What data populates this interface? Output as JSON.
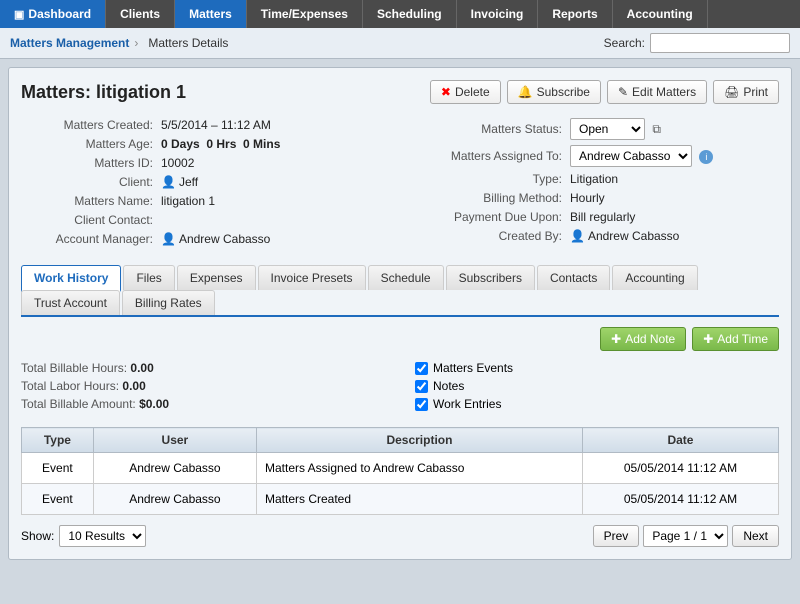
{
  "nav": {
    "items": [
      {
        "id": "dashboard",
        "label": "Dashboard",
        "icon": "▣",
        "active": false
      },
      {
        "id": "clients",
        "label": "Clients",
        "icon": "",
        "active": false
      },
      {
        "id": "matters",
        "label": "Matters",
        "icon": "",
        "active": true
      },
      {
        "id": "time_expenses",
        "label": "Time/Expenses",
        "icon": "",
        "active": false
      },
      {
        "id": "scheduling",
        "label": "Scheduling",
        "icon": "",
        "active": false
      },
      {
        "id": "invoicing",
        "label": "Invoicing",
        "icon": "",
        "active": false
      },
      {
        "id": "reports",
        "label": "Reports",
        "icon": "",
        "active": false
      },
      {
        "id": "accounting",
        "label": "Accounting",
        "icon": "",
        "active": false
      }
    ]
  },
  "breadcrumb": {
    "parent": "Matters Management",
    "current": "Matters Details"
  },
  "search": {
    "label": "Search:",
    "placeholder": ""
  },
  "page": {
    "title": "Matters: litigation 1"
  },
  "buttons": {
    "delete": "Delete",
    "subscribe": "Subscribe",
    "edit": "Edit Matters",
    "print": "Print"
  },
  "details": {
    "left": [
      {
        "label": "Matters Created:",
        "value": "5/5/2014 – 11:12 AM"
      },
      {
        "label": "Matters Age:",
        "value": "0 Days  0 Hrs  0 Mins"
      },
      {
        "label": "Matters ID:",
        "value": "10002"
      },
      {
        "label": "Client:",
        "value": "Jeff",
        "icon": true
      },
      {
        "label": "Matters Name:",
        "value": "litigation 1"
      },
      {
        "label": "Client Contact:",
        "value": ""
      },
      {
        "label": "Account Manager:",
        "value": "Andrew Cabasso",
        "icon": true
      }
    ],
    "right": [
      {
        "label": "Matters Status:",
        "value": "Open",
        "type": "select"
      },
      {
        "label": "Matters Assigned To:",
        "value": "Andrew Cabasso",
        "type": "select_info"
      },
      {
        "label": "Type:",
        "value": "Litigation"
      },
      {
        "label": "Billing Method:",
        "value": "Hourly"
      },
      {
        "label": "Payment Due Upon:",
        "value": "Bill regularly"
      },
      {
        "label": "Created By:",
        "value": "Andrew Cabasso",
        "icon": true
      }
    ]
  },
  "tabs": [
    {
      "id": "work_history",
      "label": "Work History",
      "active": true
    },
    {
      "id": "files",
      "label": "Files",
      "active": false
    },
    {
      "id": "expenses",
      "label": "Expenses",
      "active": false
    },
    {
      "id": "invoice_presets",
      "label": "Invoice Presets",
      "active": false
    },
    {
      "id": "schedule",
      "label": "Schedule",
      "active": false
    },
    {
      "id": "subscribers",
      "label": "Subscribers",
      "active": false
    },
    {
      "id": "contacts",
      "label": "Contacts",
      "active": false
    },
    {
      "id": "accounting",
      "label": "Accounting",
      "active": false
    },
    {
      "id": "trust_account",
      "label": "Trust Account",
      "active": false
    },
    {
      "id": "billing_rates",
      "label": "Billing Rates",
      "active": false
    }
  ],
  "tab_actions": {
    "add_note": "Add Note",
    "add_time": "Add Time"
  },
  "summary": {
    "billable_hours_label": "Total Billable Hours:",
    "billable_hours_value": "0.00",
    "labor_hours_label": "Total Labor Hours:",
    "labor_hours_value": "0.00",
    "billable_amount_label": "Total Billable Amount:",
    "billable_amount_value": "$0.00",
    "checkboxes": [
      {
        "label": "Matters Events",
        "checked": true
      },
      {
        "label": "Notes",
        "checked": true
      },
      {
        "label": "Work Entries",
        "checked": true
      }
    ]
  },
  "table": {
    "columns": [
      "Type",
      "User",
      "Description",
      "Date"
    ],
    "rows": [
      {
        "type": "Event",
        "user": "Andrew Cabasso",
        "description": "Matters Assigned to Andrew Cabasso",
        "date": "05/05/2014 11:12 AM"
      },
      {
        "type": "Event",
        "user": "Andrew Cabasso",
        "description": "Matters Created",
        "date": "05/05/2014 11:12 AM"
      }
    ]
  },
  "pagination": {
    "show_label": "Show:",
    "results_option": "10 Results",
    "prev_label": "Prev",
    "page_label": "Page 1 / 1",
    "next_label": "Next"
  }
}
